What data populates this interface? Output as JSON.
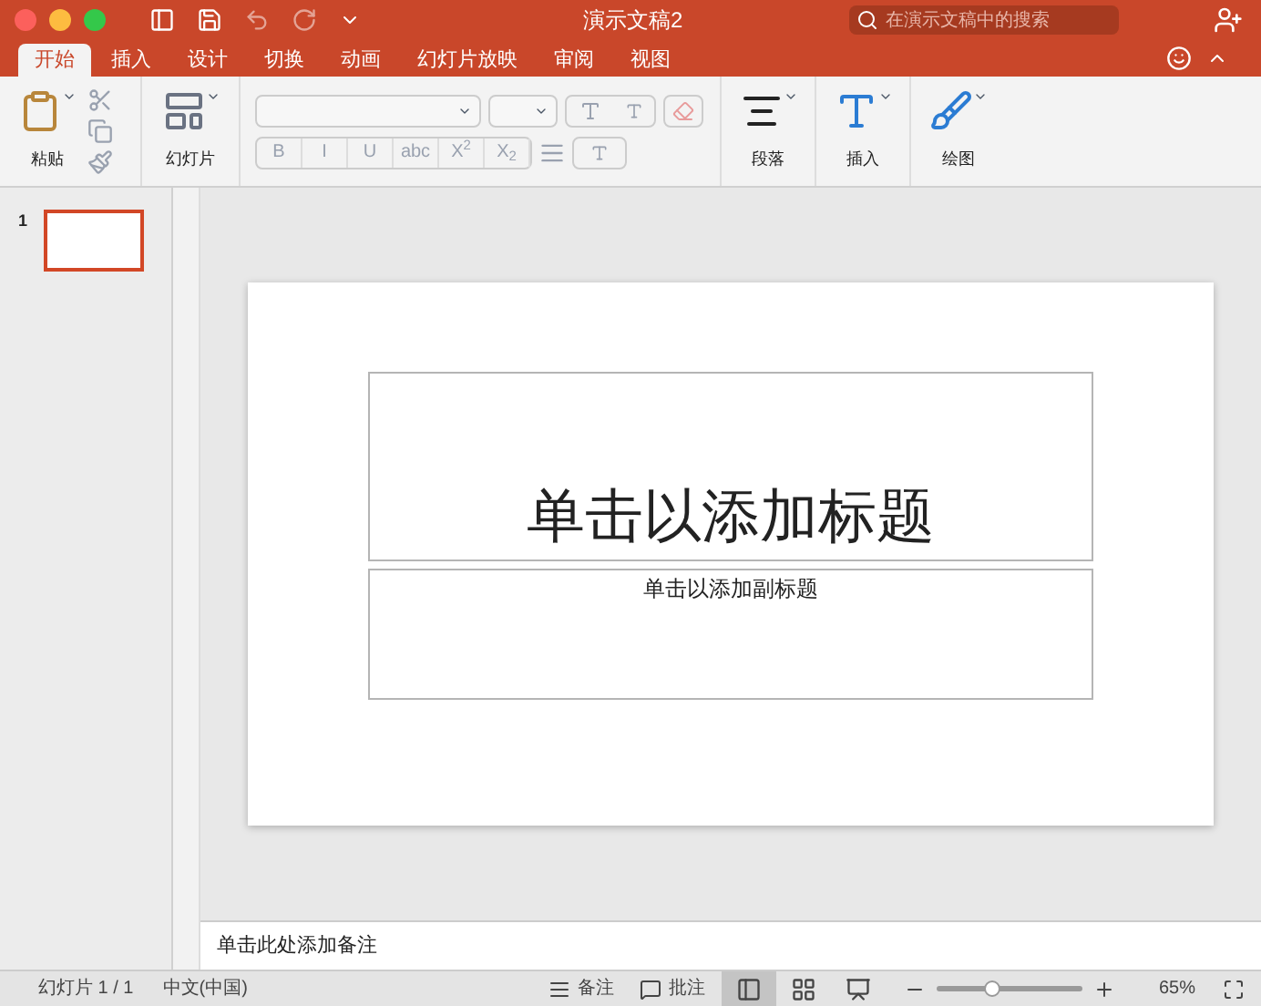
{
  "window": {
    "title": "演示文稿2"
  },
  "search": {
    "placeholder": "在演示文稿中的搜索"
  },
  "tabs": [
    {
      "label": "开始",
      "selected": true
    },
    {
      "label": "插入",
      "selected": false
    },
    {
      "label": "设计",
      "selected": false
    },
    {
      "label": "切换",
      "selected": false
    },
    {
      "label": "动画",
      "selected": false
    },
    {
      "label": "幻灯片放映",
      "selected": false
    },
    {
      "label": "审阅",
      "selected": false
    },
    {
      "label": "视图",
      "selected": false
    }
  ],
  "ribbon": {
    "paste": "粘贴",
    "slide": "幻灯片",
    "format_buttons": [
      "B",
      "I",
      "U",
      "abc",
      "X$^{2}$",
      "X$_{2}$"
    ],
    "paragraph": "段落",
    "insert": "插入",
    "draw": "绘图"
  },
  "thumbnails": [
    {
      "number": "1",
      "selected": true
    }
  ],
  "slide": {
    "title_placeholder": "单击以添加标题",
    "subtitle_placeholder": "单击以添加副标题"
  },
  "notes": {
    "placeholder": "单击此处添加备注"
  },
  "status_bar": {
    "slide_count": "幻灯片 1 / 1",
    "language": "中文(中国)",
    "notes_button": "备注",
    "comments_button": "批注",
    "views": [
      {
        "kind": "normal",
        "selected": true
      },
      {
        "kind": "sorter",
        "selected": false
      },
      {
        "kind": "reading",
        "selected": false
      }
    ],
    "zoom": {
      "level": 0.38,
      "reading": "65%"
    }
  }
}
